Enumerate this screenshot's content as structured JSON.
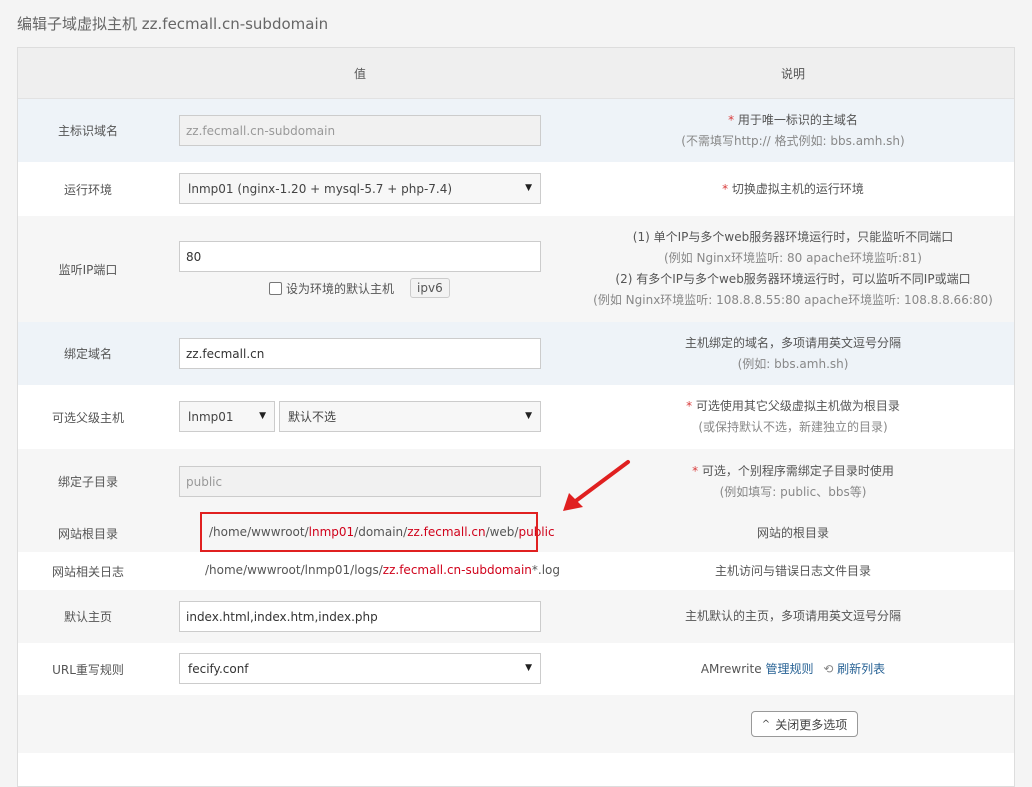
{
  "page": {
    "title": "编辑子域虚拟主机 zz.fecmall.cn-subdomain"
  },
  "table": {
    "col_value": "值",
    "col_desc": "说明"
  },
  "rows": {
    "main_domain": {
      "label": "主标识域名",
      "value": "zz.fecmall.cn-subdomain",
      "desc_line1": "用于唯一标识的主域名",
      "desc_line2": "(不需填写http:// 格式例如: bbs.amh.sh)"
    },
    "env": {
      "label": "运行环境",
      "value": "lnmp01 (nginx-1.20 + mysql-5.7 + php-7.4)",
      "desc": "切换虚拟主机的运行环境"
    },
    "listen": {
      "label": "监听IP端口",
      "value": "80",
      "checkbox_label": "设为环境的默认主机",
      "ipv6_label": "ipv6",
      "desc_line1": "(1) 单个IP与多个web服务器环境运行时，只能监听不同端口",
      "desc_line2": "(例如 Nginx环境监听: 80   apache环境监听:81)",
      "desc_line3": "(2) 有多个IP与多个web服务器环境运行时，可以监听不同IP或端口",
      "desc_line4": "(例如 Nginx环境监听: 108.8.8.55:80   apache环境监听: 108.8.8.66:80)"
    },
    "bind_domain": {
      "label": "绑定域名",
      "value": "zz.fecmall.cn",
      "desc_line1": "主机绑定的域名，多项请用英文逗号分隔",
      "desc_line2": "(例如: bbs.amh.sh)"
    },
    "parent": {
      "label": "可选父级主机",
      "env_value": "lnmp01",
      "parent_value": "默认不选",
      "desc_line1": "可选使用其它父级虚拟主机做为根目录",
      "desc_line2": "(或保持默认不选，新建独立的目录)"
    },
    "subdir": {
      "label": "绑定子目录",
      "value": "public",
      "desc_line1": "可选，个别程序需绑定子目录时使用",
      "desc_line2": "(例如填写: public、bbs等)"
    },
    "root": {
      "label": "网站根目录",
      "p1": "/home/wwwroot/",
      "p2": "lnmp01",
      "p3": "/domain/",
      "p4": "zz.fecmall.cn",
      "p5": "/web/",
      "p6": "public",
      "desc": "网站的根目录"
    },
    "log": {
      "label": "网站相关日志",
      "p1": "/home/wwwroot/lnmp01/logs/",
      "p2": "zz.fecmall.cn-subdomain",
      "p3": "*.log",
      "desc": "主机访问与错误日志文件目录"
    },
    "index": {
      "label": "默认主页",
      "value": "index.html,index.htm,index.php",
      "desc": "主机默认的主页，多项请用英文逗号分隔"
    },
    "rewrite": {
      "label": "URL重写规则",
      "value": "fecify.conf",
      "desc_prefix": "AMrewrite",
      "manage_label": "管理规则",
      "refresh_label": "刷新列表"
    }
  },
  "footer": {
    "close_more_label": "关闭更多选项"
  },
  "colors": {
    "required": "#d93c3c",
    "highlight": "#e02020",
    "link": "#2a6496"
  }
}
